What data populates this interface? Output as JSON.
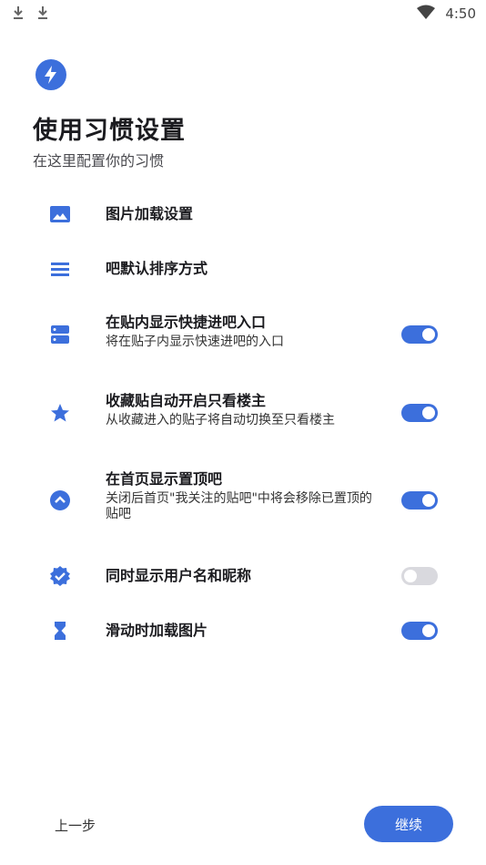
{
  "status_bar": {
    "time": "4:50"
  },
  "header": {
    "title": "使用习惯设置",
    "subtitle": "在这里配置你的习惯"
  },
  "settings": [
    {
      "label": "图片加载设置",
      "icon": "image-icon"
    },
    {
      "label": "吧默认排序方式",
      "icon": "sort-lines-icon"
    },
    {
      "label": "在贴内显示快捷进吧入口",
      "desc": "将在贴子内显示快速进吧的入口",
      "icon": "storage-icon",
      "enabled": true
    },
    {
      "label": "收藏贴自动开启只看楼主",
      "desc": "从收藏进入的贴子将自动切换至只看楼主",
      "icon": "star-icon",
      "enabled": true
    },
    {
      "label": "在首页显示置顶吧",
      "desc": "关闭后首页\"我关注的贴吧\"中将会移除已置顶的贴吧",
      "icon": "chevron-up-circle-icon",
      "enabled": true
    },
    {
      "label": "同时显示用户名和昵称",
      "icon": "verified-badge-icon",
      "enabled": false
    },
    {
      "label": "滑动时加载图片",
      "icon": "hourglass-icon",
      "enabled": true
    }
  ],
  "footer": {
    "back_label": "上一步",
    "continue_label": "继续"
  },
  "colors": {
    "accent": "#3c6fdc",
    "switch_off": "#d9d9de"
  }
}
